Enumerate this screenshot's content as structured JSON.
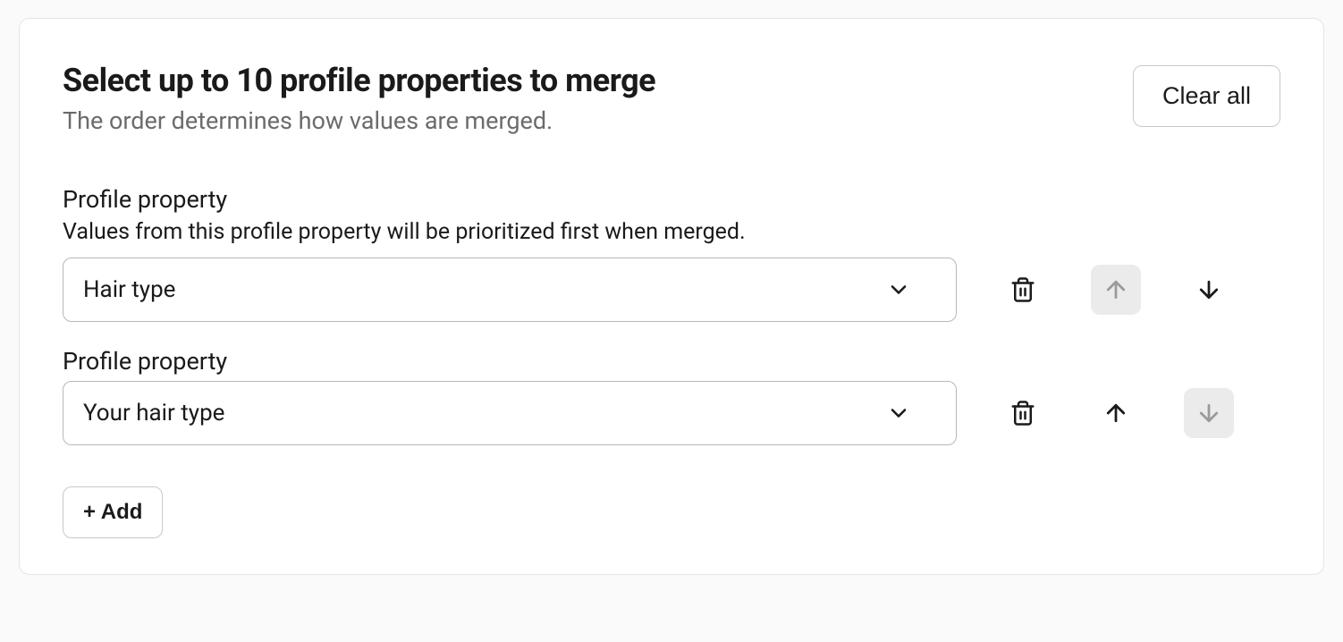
{
  "header": {
    "title": "Select up to 10 profile properties to merge",
    "subtitle": "The order determines how values are merged.",
    "clear_all_label": "Clear all"
  },
  "properties": [
    {
      "label": "Profile property",
      "hint": "Values from this profile property will be prioritized first when merged.",
      "selected_value": "Hair type",
      "move_up_disabled": true,
      "move_down_disabled": false
    },
    {
      "label": "Profile property",
      "hint": "",
      "selected_value": "Your hair type",
      "move_up_disabled": false,
      "move_down_disabled": true
    }
  ],
  "add_button_label": "+ Add"
}
